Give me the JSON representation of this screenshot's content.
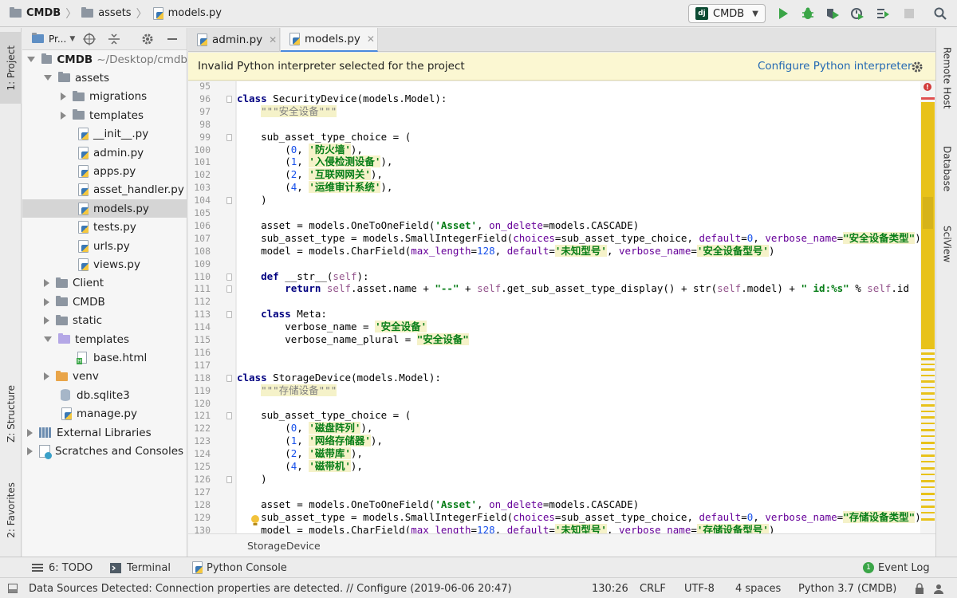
{
  "breadcrumb": {
    "project": "CMDB",
    "folder": "assets",
    "file": "models.py"
  },
  "run_config": {
    "label": "CMDB"
  },
  "toolbar_icons": [
    "run-icon",
    "debug-icon",
    "coverage-icon",
    "profile-icon",
    "build-icon",
    "stop-icon",
    "search-icon"
  ],
  "left_tabs": {
    "project": "1: Project",
    "structure": "Z: Structure",
    "favorites": "2: Favorites"
  },
  "right_tabs": {
    "remote_host": "Remote Host",
    "database": "Database",
    "sciview": "SciView"
  },
  "project_panel": {
    "header_label": "Pr...",
    "tree": [
      {
        "label": "CMDB",
        "suffix": "~/Desktop/cmdb",
        "indent": 0,
        "arrow": "d",
        "icon": "folder",
        "bold": true
      },
      {
        "label": "assets",
        "indent": 1,
        "arrow": "d",
        "icon": "folder"
      },
      {
        "label": "migrations",
        "indent": 2,
        "arrow": "r",
        "icon": "folder"
      },
      {
        "label": "templates",
        "indent": 2,
        "arrow": "r",
        "icon": "folder"
      },
      {
        "label": "__init__.py",
        "indent": 3,
        "arrow": "",
        "icon": "py"
      },
      {
        "label": "admin.py",
        "indent": 3,
        "arrow": "",
        "icon": "py"
      },
      {
        "label": "apps.py",
        "indent": 3,
        "arrow": "",
        "icon": "py"
      },
      {
        "label": "asset_handler.py",
        "indent": 3,
        "arrow": "",
        "icon": "py"
      },
      {
        "label": "models.py",
        "indent": 3,
        "arrow": "",
        "icon": "py",
        "selected": true
      },
      {
        "label": "tests.py",
        "indent": 3,
        "arrow": "",
        "icon": "py"
      },
      {
        "label": "urls.py",
        "indent": 3,
        "arrow": "",
        "icon": "py"
      },
      {
        "label": "views.py",
        "indent": 3,
        "arrow": "",
        "icon": "py"
      },
      {
        "label": "Client",
        "indent": 1,
        "arrow": "r",
        "icon": "folder"
      },
      {
        "label": "CMDB",
        "indent": 1,
        "arrow": "r",
        "icon": "folder"
      },
      {
        "label": "static",
        "indent": 1,
        "arrow": "r",
        "icon": "folder"
      },
      {
        "label": "templates",
        "indent": 1,
        "arrow": "d",
        "icon": "folder-purple"
      },
      {
        "label": "base.html",
        "indent": 3,
        "arrow": "",
        "icon": "html"
      },
      {
        "label": "venv",
        "indent": 1,
        "arrow": "r",
        "icon": "folder-orange"
      },
      {
        "label": "db.sqlite3",
        "indent": 2,
        "arrow": "",
        "icon": "db"
      },
      {
        "label": "manage.py",
        "indent": 2,
        "arrow": "",
        "icon": "py"
      },
      {
        "label": "External Libraries",
        "indent": 0,
        "arrow": "r",
        "icon": "lib"
      },
      {
        "label": "Scratches and Consoles",
        "indent": 0,
        "arrow": "r",
        "icon": "scratch"
      }
    ]
  },
  "tabs": [
    {
      "label": "admin.py",
      "active": false
    },
    {
      "label": "models.py",
      "active": true
    }
  ],
  "banner": {
    "message": "Invalid Python interpreter selected for the project",
    "link": "Configure Python interpreter"
  },
  "code": {
    "first_line": 95,
    "lines": [
      [],
      [
        [
          "kw",
          "class"
        ],
        [
          "",
          " SecurityDevice(models.Model):"
        ]
      ],
      [
        [
          "",
          "    "
        ],
        [
          "doc",
          "\"\"\"安全设备\"\"\""
        ]
      ],
      [],
      [
        [
          "",
          "    sub_asset_type_choice = ("
        ]
      ],
      [
        [
          "",
          "        ("
        ],
        [
          "num",
          "0"
        ],
        [
          "",
          ", "
        ],
        [
          "str",
          "'防火墙'"
        ],
        [
          "",
          "),"
        ]
      ],
      [
        [
          "",
          "        ("
        ],
        [
          "num",
          "1"
        ],
        [
          "",
          ", "
        ],
        [
          "str",
          "'入侵检测设备'"
        ],
        [
          "",
          "),"
        ]
      ],
      [
        [
          "",
          "        ("
        ],
        [
          "num",
          "2"
        ],
        [
          "",
          ", "
        ],
        [
          "str",
          "'互联网网关'"
        ],
        [
          "",
          "),"
        ]
      ],
      [
        [
          "",
          "        ("
        ],
        [
          "num",
          "4"
        ],
        [
          "",
          ", "
        ],
        [
          "str",
          "'运维审计系统'"
        ],
        [
          "",
          "),"
        ]
      ],
      [
        [
          "",
          "    )"
        ]
      ],
      [],
      [
        [
          "",
          "    asset = models.OneToOneField("
        ],
        [
          "str",
          "'Asset'"
        ],
        [
          "",
          ", "
        ],
        [
          "kwarg",
          "on_delete"
        ],
        [
          "",
          "=models.CASCADE)"
        ]
      ],
      [
        [
          "",
          "    sub_asset_type = models.SmallIntegerField("
        ],
        [
          "kwarg",
          "choices"
        ],
        [
          "",
          "=sub_asset_type_choice, "
        ],
        [
          "kwarg",
          "default"
        ],
        [
          "",
          "="
        ],
        [
          "num",
          "0"
        ],
        [
          "",
          ", "
        ],
        [
          "kwarg",
          "verbose_name"
        ],
        [
          "",
          "="
        ],
        [
          "str",
          "\"安全设备类型\""
        ],
        [
          "",
          ")"
        ]
      ],
      [
        [
          "",
          "    model = models.CharField("
        ],
        [
          "kwarg",
          "max_length"
        ],
        [
          "",
          "="
        ],
        [
          "num",
          "128"
        ],
        [
          "",
          ", "
        ],
        [
          "kwarg",
          "default"
        ],
        [
          "",
          "="
        ],
        [
          "str",
          "'未知型号'"
        ],
        [
          "",
          ", "
        ],
        [
          "kwarg",
          "verbose_name"
        ],
        [
          "",
          "="
        ],
        [
          "str",
          "'安全设备型号'"
        ],
        [
          "",
          ")"
        ]
      ],
      [],
      [
        [
          "",
          "    "
        ],
        [
          "kw",
          "def"
        ],
        [
          "",
          " __str__("
        ],
        [
          "self",
          "self"
        ],
        [
          "",
          "):"
        ]
      ],
      [
        [
          "",
          "        "
        ],
        [
          "kw",
          "return"
        ],
        [
          "",
          " "
        ],
        [
          "self",
          "self"
        ],
        [
          "",
          ".asset.name + "
        ],
        [
          "str",
          "\"--\""
        ],
        [
          "",
          " + "
        ],
        [
          "self",
          "self"
        ],
        [
          "",
          ".get_sub_asset_type_display() + str("
        ],
        [
          "self",
          "self"
        ],
        [
          "",
          ".model) + "
        ],
        [
          "str",
          "\" id:%s\""
        ],
        [
          "",
          " % "
        ],
        [
          "self",
          "self"
        ],
        [
          "",
          ".id"
        ]
      ],
      [],
      [
        [
          "",
          "    "
        ],
        [
          "kw",
          "class"
        ],
        [
          "",
          " Meta:"
        ]
      ],
      [
        [
          "",
          "        verbose_name = "
        ],
        [
          "str",
          "'安全设备'"
        ]
      ],
      [
        [
          "",
          "        verbose_name_plural = "
        ],
        [
          "str",
          "\"安全设备\""
        ]
      ],
      [],
      [],
      [
        [
          "kw",
          "class"
        ],
        [
          "",
          " StorageDevice(models.Model):"
        ]
      ],
      [
        [
          "",
          "    "
        ],
        [
          "doc",
          "\"\"\"存储设备\"\"\""
        ]
      ],
      [],
      [
        [
          "",
          "    sub_asset_type_choice = ("
        ]
      ],
      [
        [
          "",
          "        ("
        ],
        [
          "num",
          "0"
        ],
        [
          "",
          ", "
        ],
        [
          "str",
          "'磁盘阵列'"
        ],
        [
          "",
          "),"
        ]
      ],
      [
        [
          "",
          "        ("
        ],
        [
          "num",
          "1"
        ],
        [
          "",
          ", "
        ],
        [
          "str",
          "'网络存储器'"
        ],
        [
          "",
          "),"
        ]
      ],
      [
        [
          "",
          "        ("
        ],
        [
          "num",
          "2"
        ],
        [
          "",
          ", "
        ],
        [
          "str",
          "'磁带库'"
        ],
        [
          "",
          "),"
        ]
      ],
      [
        [
          "",
          "        ("
        ],
        [
          "num",
          "4"
        ],
        [
          "",
          ", "
        ],
        [
          "str",
          "'磁带机'"
        ],
        [
          "",
          "),"
        ]
      ],
      [
        [
          "",
          "    )"
        ]
      ],
      [],
      [
        [
          "",
          "    asset = models.OneToOneField("
        ],
        [
          "str",
          "'Asset'"
        ],
        [
          "",
          ", "
        ],
        [
          "kwarg",
          "on_delete"
        ],
        [
          "",
          "=models.CASCADE)"
        ]
      ],
      [
        [
          "",
          "    sub_asset_type = models.SmallIntegerField("
        ],
        [
          "kwarg",
          "choices"
        ],
        [
          "",
          "=sub_asset_type_choice, "
        ],
        [
          "kwarg",
          "default"
        ],
        [
          "",
          "="
        ],
        [
          "num",
          "0"
        ],
        [
          "",
          ", "
        ],
        [
          "kwarg",
          "verbose_name"
        ],
        [
          "",
          "="
        ],
        [
          "str",
          "\"存储设备类型\""
        ],
        [
          "",
          ")"
        ]
      ],
      [
        [
          "",
          "    model = models.CharField("
        ],
        [
          "kwarg",
          "max_length"
        ],
        [
          "",
          "="
        ],
        [
          "num",
          "128"
        ],
        [
          "",
          ", "
        ],
        [
          "kwarg",
          "default"
        ],
        [
          "",
          "="
        ],
        [
          "str",
          "'未知型号'"
        ],
        [
          "",
          ", "
        ],
        [
          "kwarg",
          "verbose_name"
        ],
        [
          "",
          "="
        ],
        [
          "str",
          "'存储设备型号'"
        ],
        [
          "",
          ")"
        ]
      ]
    ]
  },
  "editor_breadcrumb": "StorageDevice",
  "bottom_tools": {
    "todo": "6: TODO",
    "terminal": "Terminal",
    "python_console": "Python Console",
    "event_log": "Event Log",
    "event_count": "1"
  },
  "status": {
    "message": "Data Sources Detected: Connection properties are detected. // Configure (2019-06-06 20:47)",
    "position": "130:26",
    "line_sep": "CRLF",
    "encoding": "UTF-8",
    "indent": "4 spaces",
    "interpreter": "Python 3.7 (CMDB)"
  },
  "colors": {
    "accent": "#4a89dc",
    "banner_bg": "#fbf7d2",
    "warning_mark": "#e8c21a",
    "error": "#d23b3b"
  }
}
